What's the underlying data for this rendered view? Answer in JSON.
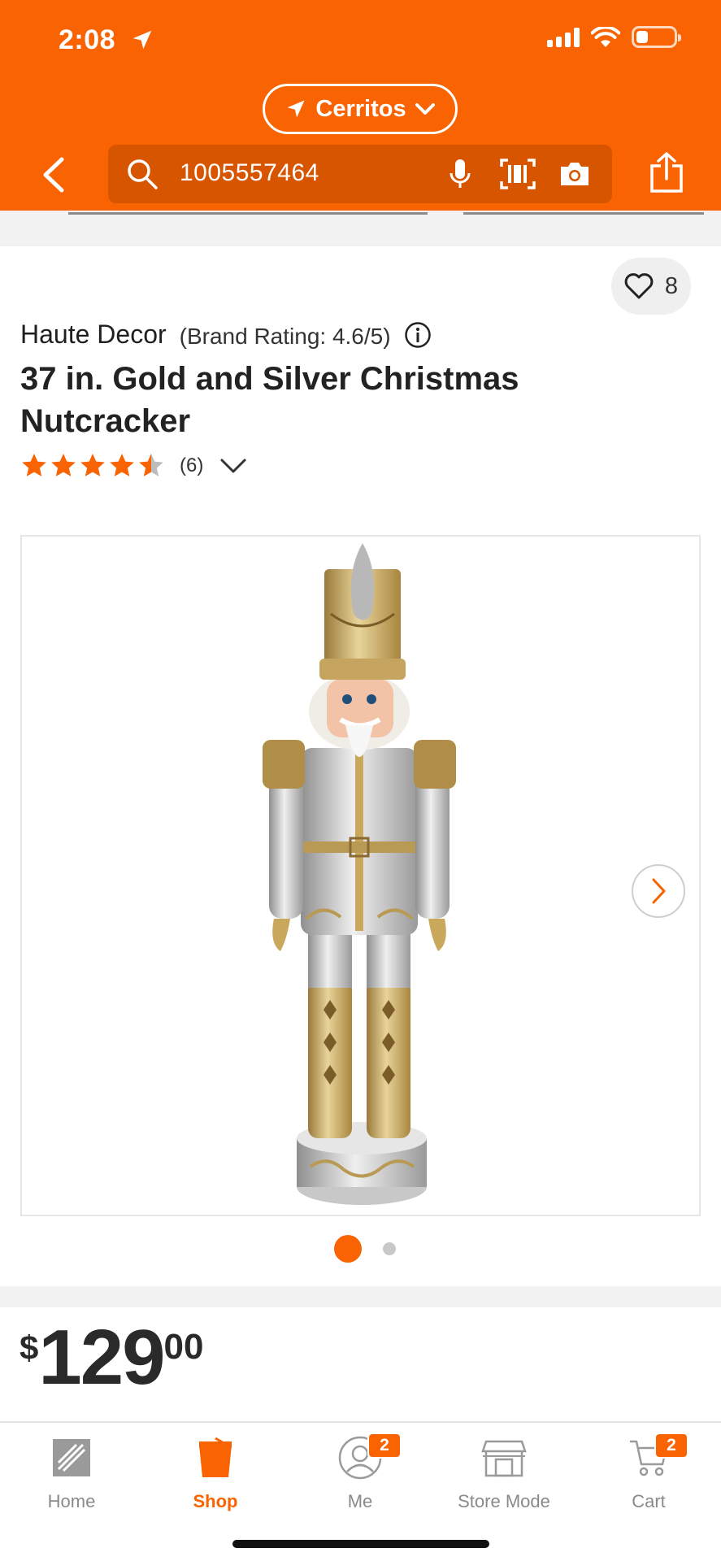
{
  "colors": {
    "brand": "#f96302",
    "search_bg": "#d85500",
    "text": "#1f1f1f",
    "muted": "#8a8a8a"
  },
  "status_bar": {
    "time": "2:08",
    "location_arrow": "location-arrow-icon",
    "signal": "cellular-signal-icon",
    "wifi": "wifi-icon",
    "battery": "battery-low-icon"
  },
  "header": {
    "store": "Cerritos",
    "search_value": "1005557464",
    "icons": [
      "back-chevron-icon",
      "search-icon",
      "mic-icon",
      "barcode-icon",
      "camera-icon",
      "share-icon"
    ]
  },
  "product": {
    "favorite_count": "8",
    "brand": "Haute Decor",
    "brand_rating": "(Brand Rating: 4.6/5)",
    "title": "37 in. Gold and Silver Christmas Nutcracker",
    "rating": 4.5,
    "review_count": "(6)",
    "image_count": 2,
    "active_image": 1,
    "price": {
      "symbol": "$",
      "dollars": "129",
      "cents": "00"
    }
  },
  "bottom_nav": {
    "items": [
      {
        "label": "Home",
        "icon": "home-depot-logo-icon",
        "active": false
      },
      {
        "label": "Shop",
        "icon": "shop-bucket-icon",
        "active": true
      },
      {
        "label": "Me",
        "icon": "profile-icon",
        "active": false,
        "badge": "2"
      },
      {
        "label": "Store Mode",
        "icon": "store-icon",
        "active": false
      },
      {
        "label": "Cart",
        "icon": "cart-icon",
        "active": false,
        "badge": "2"
      }
    ]
  }
}
